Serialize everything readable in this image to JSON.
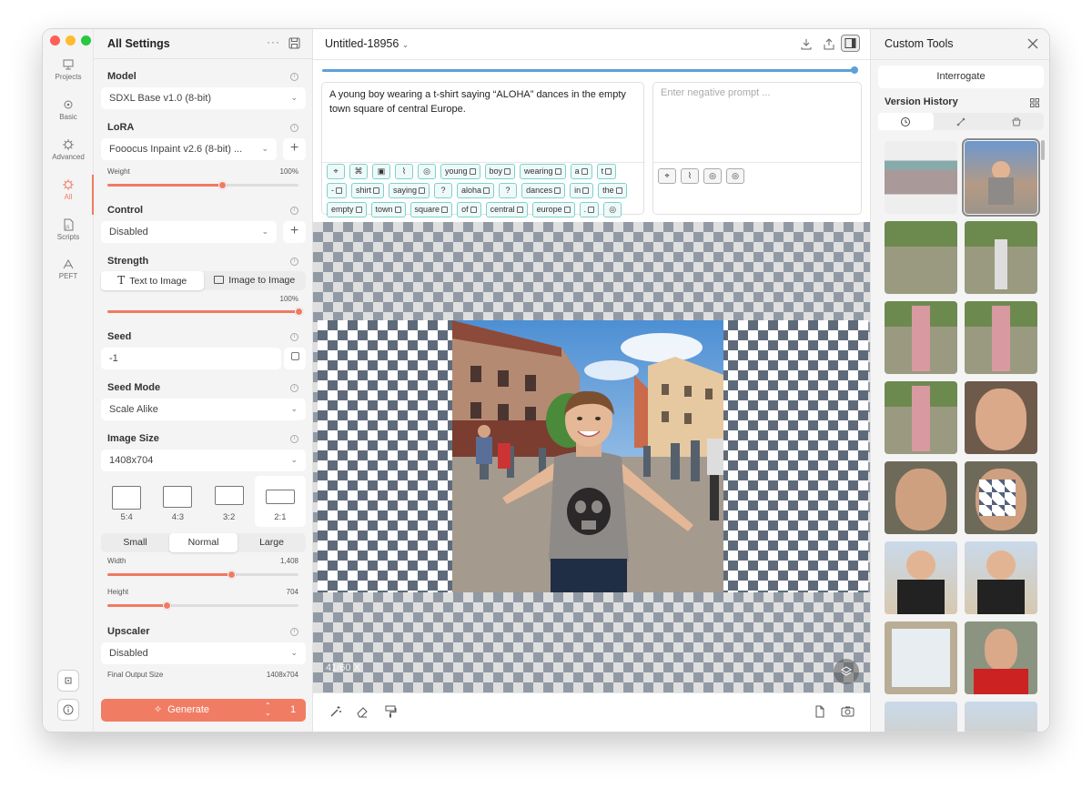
{
  "window": {
    "lights": [
      "#ff5f57",
      "#febc2e",
      "#28c840"
    ]
  },
  "rail": {
    "items": [
      {
        "label": "Projects",
        "icon": "projects-icon"
      },
      {
        "label": "Basic",
        "icon": "basic-icon"
      },
      {
        "label": "Advanced",
        "icon": "advanced-icon"
      },
      {
        "label": "All",
        "icon": "all-icon",
        "active": true
      },
      {
        "label": "Scripts",
        "icon": "scripts-icon"
      },
      {
        "label": "PEFT",
        "icon": "peft-icon"
      }
    ]
  },
  "settings": {
    "title": "All Settings",
    "model": {
      "label": "Model",
      "value": "SDXL Base v1.0 (8-bit)"
    },
    "lora": {
      "label": "LoRA",
      "value": "Fooocus Inpaint v2.6 (8-bit) ...",
      "weight_label": "Weight",
      "weight_value": "100%",
      "weight_level": 0.6
    },
    "control": {
      "label": "Control",
      "value": "Disabled"
    },
    "strength": {
      "label": "Strength",
      "tab_text": "Text to Image",
      "tab_image": "Image to Image",
      "value": "100%",
      "level": 1.0
    },
    "seed": {
      "label": "Seed",
      "value": "-1"
    },
    "seed_mode": {
      "label": "Seed Mode",
      "value": "Scale Alike"
    },
    "image_size": {
      "label": "Image Size",
      "value": "1408x704",
      "ratios": [
        "5:4",
        "4:3",
        "3:2",
        "2:1"
      ],
      "selected_ratio": "2:1",
      "sizes": [
        "Small",
        "Normal",
        "Large"
      ],
      "selected_size": "Normal",
      "width_label": "Width",
      "width_value": "1,408",
      "width_level": 0.65,
      "height_label": "Height",
      "height_value": "704",
      "height_level": 0.31
    },
    "upscaler": {
      "label": "Upscaler",
      "value": "Disabled",
      "final_label": "Final Output Size",
      "final_value": "1408x704"
    },
    "generate": {
      "label": "Generate",
      "count": "1"
    }
  },
  "center": {
    "doc_title": "Untitled-18956",
    "progress": 0.99,
    "prompt": "A young boy wearing a t-shirt saying “ALOHA” dances in the empty town square of central Europe.",
    "negative_placeholder": "Enter negative prompt ...",
    "tokens": [
      "young",
      "boy",
      "wearing",
      "a",
      "t",
      "-",
      "shirt",
      "saying",
      "aloha",
      "dances",
      "in",
      "the",
      "empty",
      "town",
      "square",
      "of",
      "central",
      "europe",
      "."
    ],
    "zoom": "41/60 X"
  },
  "right": {
    "title": "Custom Tools",
    "interrogate": "Interrogate",
    "version_history": "Version History"
  }
}
